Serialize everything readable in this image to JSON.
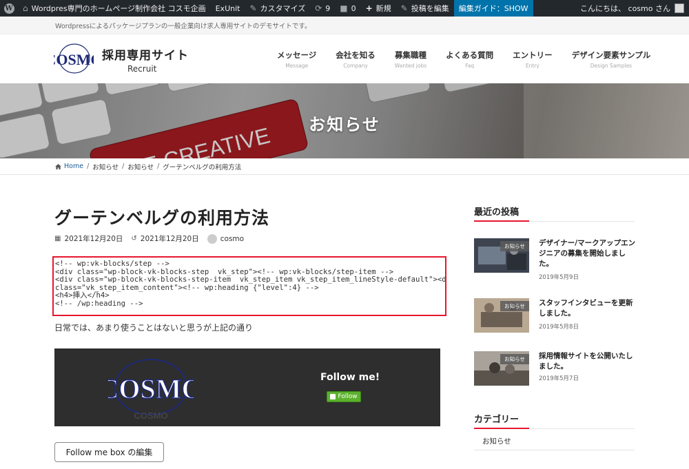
{
  "adminbar": {
    "site_name": "Wordpres専門のホームページ制作会社 コスモ企画",
    "exunit": "ExUnit",
    "customize": "カスタマイズ",
    "updates_count": "9",
    "comments_count": "0",
    "new": "新規",
    "edit_post": "投稿を編集",
    "guide": "編集ガイド：SHOW",
    "greeting": "こんにちは、 cosmo さん"
  },
  "site": {
    "description": "Wordpressによるパッケージプランの一般企業向け求人専用サイトのデモサイトです。",
    "title": "採用専用サイト",
    "subtitle": "Recruit",
    "logo_text": "COSMO"
  },
  "nav": [
    {
      "jp": "メッセージ",
      "en": "Message"
    },
    {
      "jp": "会社を知る",
      "en": "Company"
    },
    {
      "jp": "募集職種",
      "en": "Wanted jobs"
    },
    {
      "jp": "よくある質問",
      "en": "Faq"
    },
    {
      "jp": "エントリー",
      "en": "Entry"
    },
    {
      "jp": "デザイン要素サンプル",
      "en": "Design Samples"
    }
  ],
  "hero": {
    "title": "お知らせ",
    "key_text": "BE CREATIVE"
  },
  "breadcrumb": [
    "Home",
    "お知らせ",
    "お知らせ",
    "グーテンベルグの利用方法"
  ],
  "post": {
    "title": "グーテンベルグの利用方法",
    "published": "2021年12月20日",
    "updated": "2021年12月20日",
    "author": "cosmo",
    "code_lines": [
      "<!-- wp:vk-blocks/step -->",
      "<div class=\"wp-block-vk-blocks-step  vk_step\"><!-- wp:vk-blocks/step-item -->",
      "<div class=\"wp-block-vk-blocks-step-item  vk_step_item vk_step_item_lineStyle-default\"><div",
      "class=\"vk_step_item_content\"><!-- wp:heading {\"level\":4} -->",
      "<h4>挿入</h4>",
      "<!-- /wp:heading -->"
    ],
    "body": "日常では、あまり使うことはないと思うが上記の通り",
    "follow_logo": "COSMO",
    "follow_logo_sub": "COSMO",
    "follow_me": "Follow me!",
    "follow_button": "Follow",
    "edit_button": "Follow me box の編集"
  },
  "sidebar": {
    "recent_heading": "最近の投稿",
    "recent": [
      {
        "label": "お知らせ",
        "title": "デザイナー/マークアップエンジニアの募集を開始しました。",
        "date": "2019年5月9日"
      },
      {
        "label": "お知らせ",
        "title": "スタッフインタビューを更新しました。",
        "date": "2019年5月8日"
      },
      {
        "label": "お知らせ",
        "title": "採用情報サイトを公開いたしました。",
        "date": "2019年5月7日"
      }
    ],
    "category_heading": "カテゴリー",
    "categories": [
      "お知らせ"
    ]
  },
  "colors": {
    "accent": "#e6162d",
    "adminbar": "#23282d",
    "guide": "#0073aa",
    "follow_button": "#5cb12d"
  }
}
